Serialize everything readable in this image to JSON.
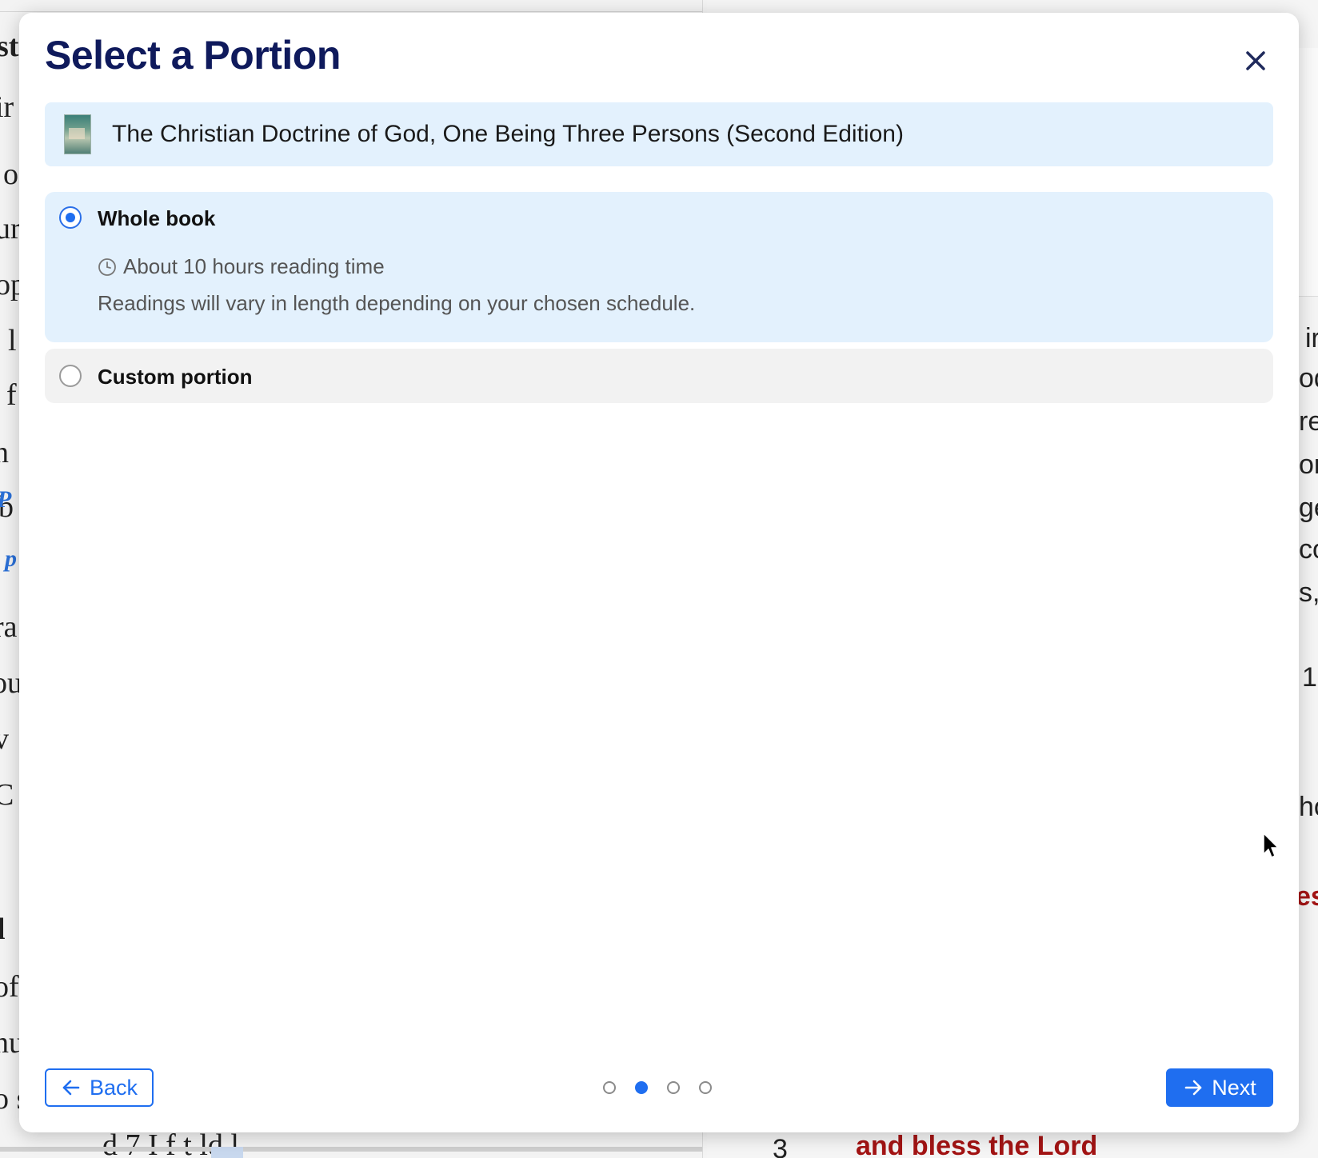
{
  "background": {
    "left_fragments": [
      "st",
      "ir",
      "o",
      "ur",
      "op",
      "l",
      "f",
      "n",
      "b",
      "p",
      "ra",
      "ou",
      "v",
      "C",
      "l",
      "of",
      "nu",
      "o s"
    ],
    "left_blue_marker": "P",
    "right_fragments": [
      "ir",
      "od",
      "re",
      "or",
      "ge",
      "co",
      "s,",
      "1:",
      "ho",
      "es"
    ],
    "bottom_left_text": "d    7 I       f t          ld   l",
    "bottom_right_number": "3",
    "bottom_right_text": "and bless the Lord"
  },
  "modal": {
    "title": "Select a Portion",
    "close_icon": "close-icon",
    "book": {
      "title": "The Christian Doctrine of God, One Being Three Persons (Second Edition)"
    },
    "options": {
      "whole": {
        "label": "Whole book",
        "selected": true,
        "reading_time": "About 10 hours reading time",
        "note": "Readings will vary in length depending on your chosen schedule."
      },
      "custom": {
        "label": "Custom portion",
        "selected": false
      }
    },
    "footer": {
      "back_label": "Back",
      "next_label": "Next",
      "steps_total": 4,
      "step_current": 2
    }
  },
  "colors": {
    "accent": "#1f6ef0",
    "title": "#0f1a5c",
    "highlight_bg": "#e3f1fd",
    "scripture_red": "#a31414"
  }
}
